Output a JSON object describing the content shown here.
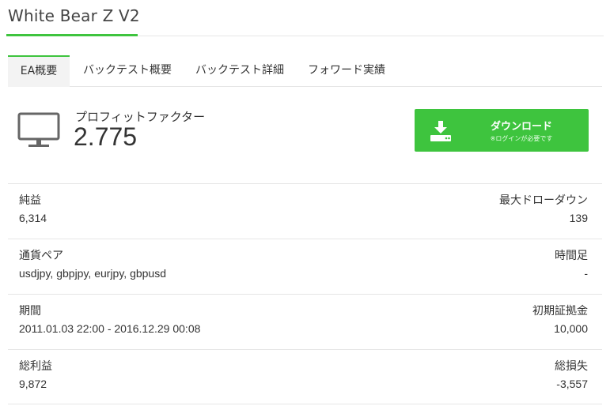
{
  "page": {
    "title": "White Bear Z V2"
  },
  "colors": {
    "accent": "#3ec43e",
    "text": "#333333",
    "divider": "#e6e6e6"
  },
  "tabs": [
    {
      "label": "EA概要",
      "active": true
    },
    {
      "label": "バックテスト概要",
      "active": false
    },
    {
      "label": "バックテスト詳細",
      "active": false
    },
    {
      "label": "フォワード実績",
      "active": false
    }
  ],
  "summary": {
    "icon": "monitor-icon",
    "label": "プロフィットファクター",
    "value": "2.775"
  },
  "download": {
    "icon": "download-icon",
    "label": "ダウンロード",
    "note": "※ログインが必要です"
  },
  "stats": [
    {
      "left": {
        "label": "純益",
        "value": "6,314"
      },
      "right": {
        "label": "最大ドローダウン",
        "value": "139"
      }
    },
    {
      "left": {
        "label": "通貨ペア",
        "value": "usdjpy, gbpjpy, eurjpy, gbpusd"
      },
      "right": {
        "label": "時間足",
        "value": "-"
      }
    },
    {
      "left": {
        "label": "期間",
        "value": "2011.01.03 22:00 - 2016.12.29 00:08"
      },
      "right": {
        "label": "初期証拠金",
        "value": "10,000"
      }
    },
    {
      "left": {
        "label": "総利益",
        "value": "9,872"
      },
      "right": {
        "label": "総損失",
        "value": "-3,557"
      }
    }
  ]
}
